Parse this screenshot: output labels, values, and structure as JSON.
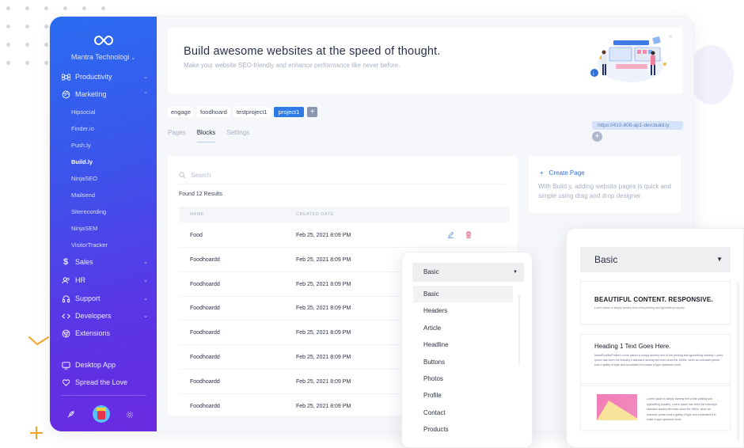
{
  "sidebar": {
    "org_name": "Mantra Technologi",
    "items": [
      {
        "label": "Productivity",
        "icon": "command-icon",
        "expandable": true
      },
      {
        "label": "Marketing",
        "icon": "globe-icon",
        "expandable": true,
        "expanded": true
      },
      {
        "label": "Sales",
        "icon": "dollar-icon",
        "expandable": true
      },
      {
        "label": "HR",
        "icon": "users-icon",
        "expandable": true
      },
      {
        "label": "Support",
        "icon": "headphones-icon",
        "expandable": true
      },
      {
        "label": "Developers",
        "icon": "code-icon",
        "expandable": true
      },
      {
        "label": "Extensions",
        "icon": "chrome-icon",
        "expandable": false
      },
      {
        "label": "Desktop App",
        "icon": "monitor-icon",
        "expandable": false
      },
      {
        "label": "Spread the Love",
        "icon": "heart-icon",
        "expandable": false
      }
    ],
    "marketing_subitems": [
      "Hipsocial",
      "Finder.io",
      "Push.ly",
      "Build.ly",
      "NinjaSEO",
      "Mailsend",
      "Siterecording",
      "NinjaSEM",
      "VisitorTracker"
    ],
    "active_subitem": "Build.ly"
  },
  "hero": {
    "title": "Build awesome websites at the speed of thought.",
    "subtitle": "Make your website SEO-friendly and enhance performance like never before.",
    "close": "×"
  },
  "projects": {
    "chips": [
      "engage",
      "foodhoard",
      "testproject1",
      "project1"
    ],
    "active": "project1",
    "add_label": "+"
  },
  "tabs": {
    "items": [
      "Pages",
      "Blocks",
      "Settings"
    ],
    "active": "Blocks"
  },
  "url": {
    "value": "https://410-808-ap1-dev.build.ly",
    "add_label": "+"
  },
  "table": {
    "search_placeholder": "Search",
    "found_text": "Found 12 Results",
    "columns": [
      "NAME",
      "CREATED DATE"
    ],
    "rows": [
      {
        "name": "Food",
        "date": "Feb 25, 2021 8:09 PM"
      },
      {
        "name": "Foodhoardd",
        "date": "Feb 25, 2021 8:09 PM"
      },
      {
        "name": "Foodhoardd",
        "date": "Feb 25, 2021 8:09 PM"
      },
      {
        "name": "Foodhoardd",
        "date": "Feb 25, 2021 8:09 PM"
      },
      {
        "name": "Foodhoardd",
        "date": "Feb 25, 2021 8:09 PM"
      },
      {
        "name": "Foodhoardd",
        "date": "Feb 25, 2021 8:09 PM"
      },
      {
        "name": "Foodhoardd",
        "date": "Feb 25, 2021 8:09 PM"
      },
      {
        "name": "Foodhoardd",
        "date": "Feb 25, 2021 8:09 PM"
      }
    ]
  },
  "create_page": {
    "link": "Create Page",
    "description": "With Build.y, adding website pages is quick and simple using drag and drop designer."
  },
  "dropdown": {
    "selected": "Basic",
    "options": [
      "Basic",
      "Headers",
      "Article",
      "Headline",
      "Buttons",
      "Photos",
      "Profile",
      "Contact",
      "Products"
    ]
  },
  "preview": {
    "selected": "Basic",
    "templates": [
      {
        "heading": "BEAUTIFUL CONTENT. RESPONSIVE.",
        "text": "Lorem ipsum is simply dummy text of the printing and typesetting industry."
      },
      {
        "heading": "Heading 1 Text Goes Here.",
        "text": "NewsRoofNoPrinted Lorem Ipsum is simply dummy text of the printing and typesetting industry. Lorem Ipsum has been the industry's standard dummy text ever since the 1500s, when an unknown printer took a galley of type and scrambled it to make a type specimen book."
      },
      {
        "heading": "",
        "text": "Lorem Ipsum is simply dummy text of the printing and typesetting industry. Lorem Ipsum has been the industry's standard dummy text ever since the 1500s, when an unknown printer took a galley of type and scrambled it to make a type specimen book."
      }
    ]
  },
  "colors": {
    "accent": "#2f7be6",
    "sidebar_start": "#2a6cf0",
    "sidebar_end": "#6a2ae0",
    "delete": "#e5536b",
    "deco": "#f5a623"
  }
}
